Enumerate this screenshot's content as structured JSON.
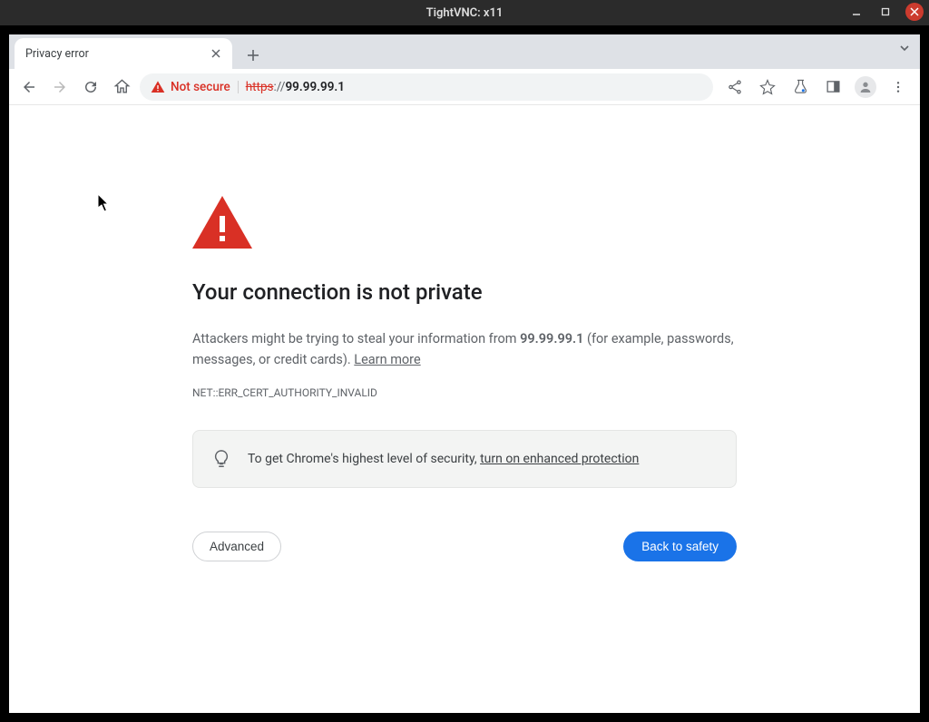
{
  "window": {
    "title": "TightVNC: x11"
  },
  "tab": {
    "title": "Privacy error"
  },
  "toolbar": {
    "security_label": "Not secure",
    "url_protocol": "https",
    "url_sep": "://",
    "url_host": "99.99.99.1"
  },
  "page": {
    "headline": "Your connection is not private",
    "warn_pre": "Attackers might be trying to steal your information from ",
    "warn_host": "99.99.99.1",
    "warn_post": " (for example, passwords, messages, or credit cards). ",
    "learn_more": "Learn more",
    "error_code": "NET::ERR_CERT_AUTHORITY_INVALID",
    "tip_pre": "To get Chrome's highest level of security, ",
    "tip_link": "turn on enhanced protection",
    "advanced": "Advanced",
    "back_to_safety": "Back to safety"
  },
  "colors": {
    "danger": "#d93025",
    "primary": "#1a73e8"
  }
}
